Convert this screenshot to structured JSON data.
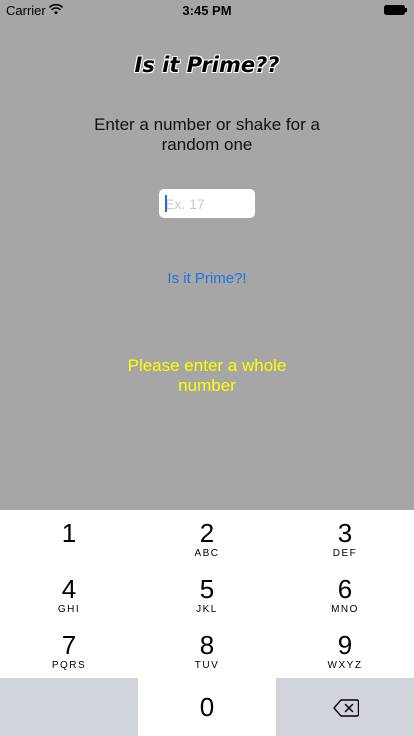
{
  "status_bar": {
    "carrier": "Carrier",
    "time": "3:45 PM"
  },
  "app": {
    "title": "Is it Prime??",
    "instruction": "Enter a number or shake for a random one",
    "input_placeholder": "Ex. 17",
    "input_value": "",
    "check_button_label": "Is it Prime?!",
    "result_message": "Please enter a whole number"
  },
  "keyboard": {
    "keys": [
      {
        "digit": "1",
        "letters": ""
      },
      {
        "digit": "2",
        "letters": "ABC"
      },
      {
        "digit": "3",
        "letters": "DEF"
      },
      {
        "digit": "4",
        "letters": "GHI"
      },
      {
        "digit": "5",
        "letters": "JKL"
      },
      {
        "digit": "6",
        "letters": "MNO"
      },
      {
        "digit": "7",
        "letters": "PQRS"
      },
      {
        "digit": "8",
        "letters": "TUV"
      },
      {
        "digit": "9",
        "letters": "WXYZ"
      },
      {
        "digit": "0",
        "letters": ""
      }
    ],
    "delete_icon": "backspace-icon"
  },
  "colors": {
    "background": "#a6a6a6",
    "accent": "#1f73e6",
    "result": "#ffff00"
  }
}
